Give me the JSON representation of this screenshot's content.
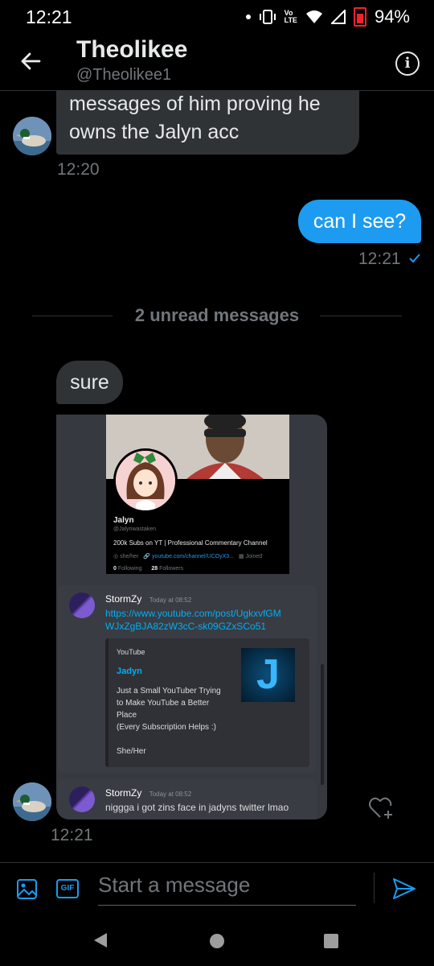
{
  "status_bar": {
    "time": "12:21",
    "lte": "Vo\nLTE",
    "battery": "94%"
  },
  "header": {
    "name": "Theolikee",
    "handle": "@Theolikee1"
  },
  "messages": {
    "m1_text": "messages of him proving he owns the Jalyn acc",
    "m1_line1": "messages of him proving he",
    "m1_line2": "owns the Jalyn acc",
    "m1_time": "12:20",
    "m2_text": "can I see?",
    "m2_time": "12:21",
    "unread": "2 unread messages",
    "m3_text": "sure",
    "m4_time": "12:21"
  },
  "embed": {
    "profile_name": "Jalyn",
    "profile_handle": "@Jalynwastaken",
    "profile_bio": "200k Subs on YT | Professional Commentary Channel",
    "profile_pronouns": "she/her",
    "profile_link": "youtube.com/channel/UCOyX3...",
    "profile_joined": "Joined",
    "following_count": "0",
    "following_label": "Following",
    "followers_count": "28",
    "followers_label": "Followers",
    "msg1_user": "StormZy",
    "msg1_time": "Today at 08:52",
    "msg1_link": "https://www.youtube.com/post/UgkxvfGMWJxZgBJA82zW3cC-sk09GZxSCo51",
    "msg1_link_l1": "https://www.youtube.com/post/UgkxvfGM",
    "msg1_link_l2": "WJxZgBJA82zW3cC-sk09GZxSCo51",
    "card_provider": "YouTube",
    "card_title": "Jadyn",
    "card_desc_l1": "Just a Small YouTuber Trying",
    "card_desc_l2": "to Make YouTube a Better",
    "card_desc_l3": "Place",
    "card_desc_l4": "(Every Subscription Helps :)",
    "card_desc_l5": "She/Her",
    "card_thumb_letter": "J",
    "msg2_user": "StormZy",
    "msg2_time": "Today at 08:52",
    "msg2_text": "niggga i got zins face in jadyns twitter lmao"
  },
  "composer": {
    "placeholder": "Start a message",
    "gif_label": "GIF"
  },
  "colors": {
    "accent": "#1d9bf0",
    "bubble_in": "#2f3336",
    "discord_bg": "#36393f",
    "link": "#00aff4"
  }
}
